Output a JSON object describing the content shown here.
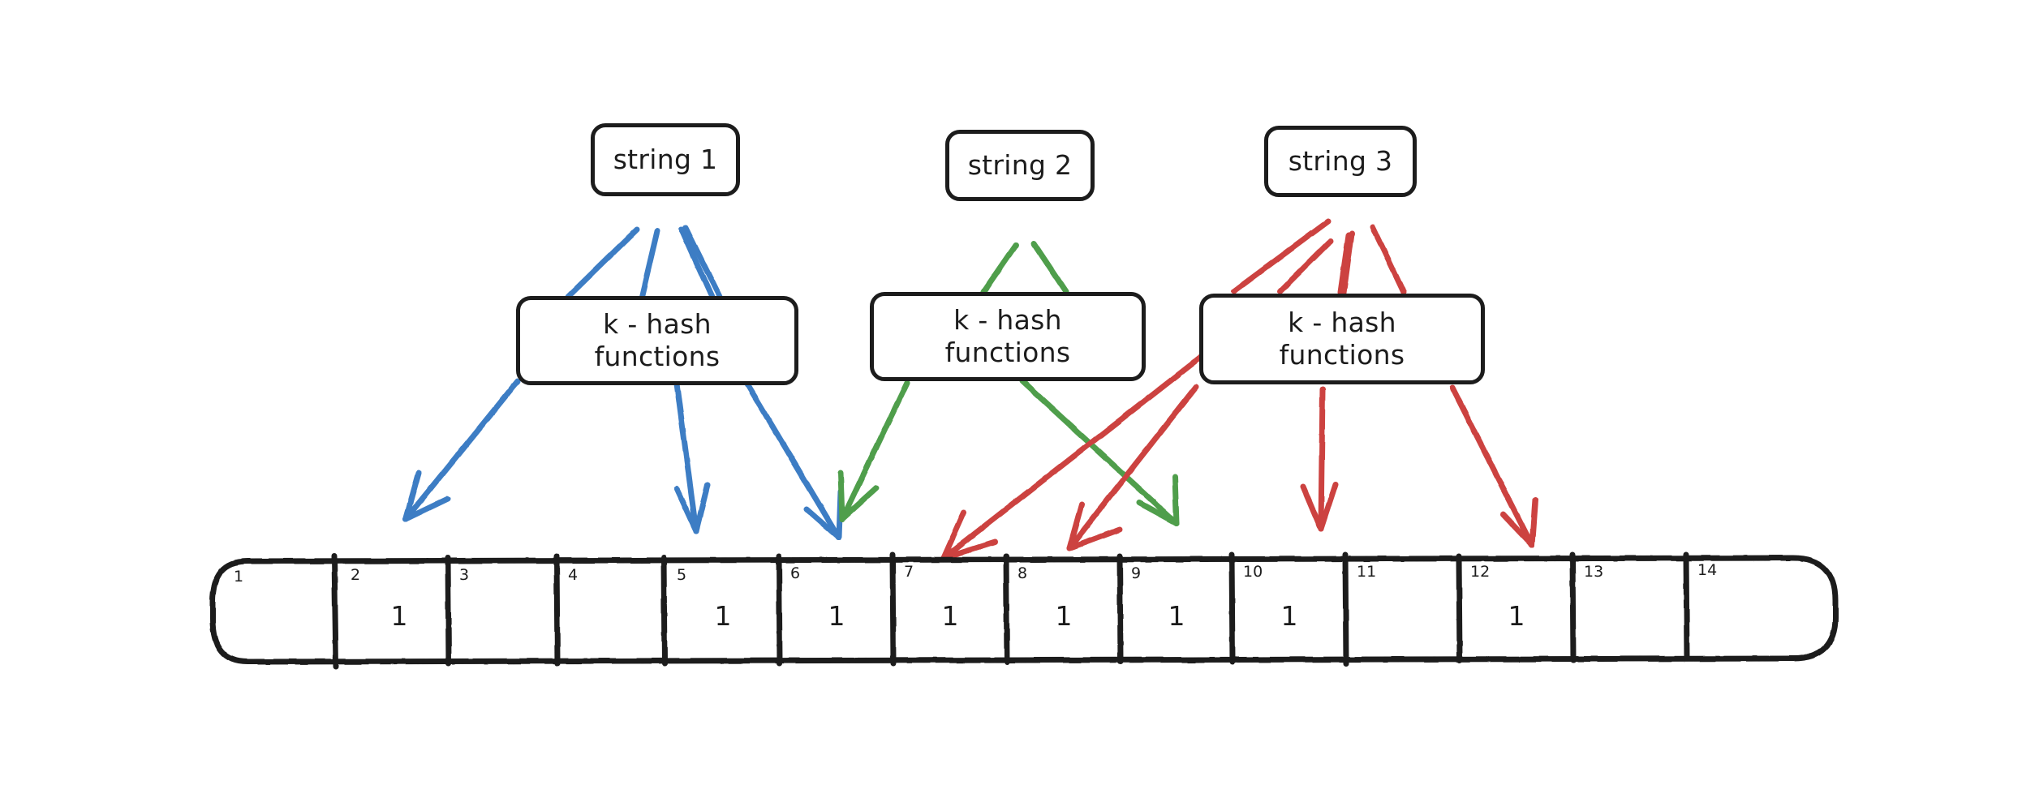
{
  "diagram": {
    "title": "bloom-filter-insertion",
    "colors": {
      "ink": "#1c1c1c",
      "blue": "#3d7dc4",
      "green": "#4f9e4c",
      "red": "#cc4340",
      "background": "#ffffff"
    }
  },
  "inputs": [
    {
      "id": "string-1",
      "label": "string 1",
      "color": "#3d7dc4"
    },
    {
      "id": "string-2",
      "label": "string 2",
      "color": "#4f9e4c"
    },
    {
      "id": "string-3",
      "label": "string 3",
      "color": "#cc4340"
    }
  ],
  "hashers": [
    {
      "id": "hash-1",
      "label": "k - hash\nfunctions",
      "color": "#3d7dc4"
    },
    {
      "id": "hash-2",
      "label": "k - hash\nfunctions",
      "color": "#4f9e4c"
    },
    {
      "id": "hash-3",
      "label": "k - hash\nfunctions",
      "color": "#cc4340"
    }
  ],
  "bit_array": {
    "length": 14,
    "cells": [
      {
        "index": "1",
        "value": ""
      },
      {
        "index": "2",
        "value": "1"
      },
      {
        "index": "3",
        "value": ""
      },
      {
        "index": "4",
        "value": ""
      },
      {
        "index": "5",
        "value": "1"
      },
      {
        "index": "6",
        "value": "1"
      },
      {
        "index": "7",
        "value": "1"
      },
      {
        "index": "8",
        "value": "1"
      },
      {
        "index": "9",
        "value": "1"
      },
      {
        "index": "10",
        "value": "1"
      },
      {
        "index": "11",
        "value": ""
      },
      {
        "index": "12",
        "value": "1"
      },
      {
        "index": "13",
        "value": ""
      },
      {
        "index": "14",
        "value": ""
      }
    ]
  },
  "mappings": [
    {
      "source": "string 1",
      "color": "#3d7dc4",
      "bits": [
        "2",
        "5",
        "6"
      ]
    },
    {
      "source": "string 2",
      "color": "#4f9e4c",
      "bits": [
        "6",
        "9"
      ]
    },
    {
      "source": "string 3",
      "color": "#cc4340",
      "bits": [
        "7",
        "8",
        "10",
        "12"
      ]
    }
  ]
}
